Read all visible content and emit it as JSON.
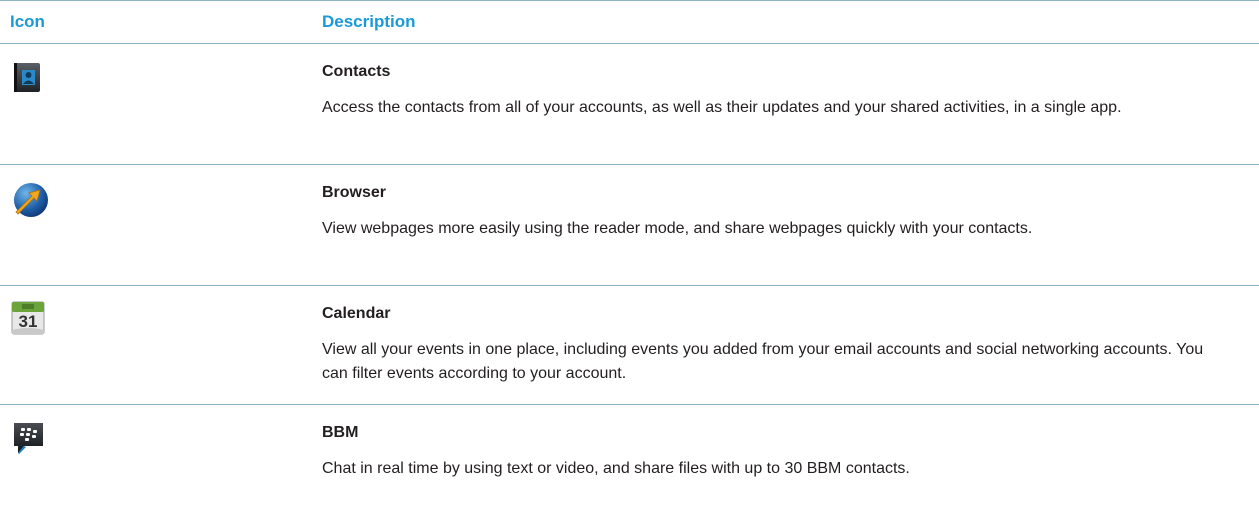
{
  "table": {
    "headers": {
      "icon": "Icon",
      "description": "Description"
    },
    "rows": [
      {
        "icon": "contacts-icon",
        "name": "Contacts",
        "description": "Access the contacts from all of your accounts, as well as their updates and your shared activities, in a single app."
      },
      {
        "icon": "browser-icon",
        "name": "Browser",
        "description": "View webpages more easily using the reader mode, and share webpages quickly with your contacts."
      },
      {
        "icon": "calendar-icon",
        "name": "Calendar",
        "calendar_day": "31",
        "description": "View all your events in one place, including events you added from your email accounts and social networking accounts. You can filter events according to your account."
      },
      {
        "icon": "bbm-icon",
        "name": "BBM",
        "description": "Chat in real time by using text or video, and share files with up to 30 BBM contacts."
      }
    ]
  },
  "colors": {
    "header_text": "#1a9ad6",
    "rule": "#8fb3c4",
    "body_text": "#231f20"
  }
}
